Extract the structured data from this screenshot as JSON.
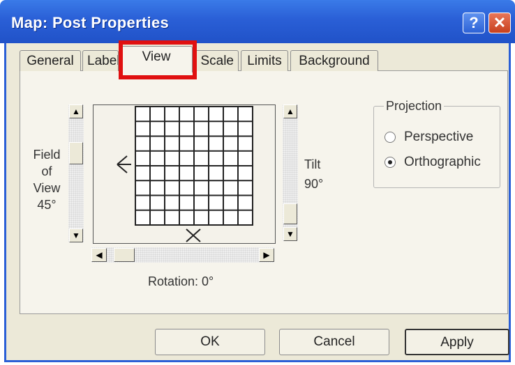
{
  "window": {
    "title": "Map: Post Properties",
    "help_glyph": "?",
    "close_glyph": "✕"
  },
  "tabs": [
    {
      "label": "General",
      "active": false
    },
    {
      "label": "Labels",
      "active": false
    },
    {
      "label": "View",
      "active": true
    },
    {
      "label": "Scale",
      "active": false
    },
    {
      "label": "Limits",
      "active": false
    },
    {
      "label": "Background",
      "active": false
    }
  ],
  "view": {
    "field_of_view": {
      "label_line1": "Field",
      "label_line2": "of",
      "label_line3": "View",
      "value": "45°"
    },
    "tilt": {
      "label": "Tilt",
      "value": "90°"
    },
    "rotation": {
      "label": "Rotation: 0°"
    }
  },
  "projection": {
    "title": "Projection",
    "options": [
      {
        "label": "Perspective",
        "selected": false
      },
      {
        "label": "Orthographic",
        "selected": true
      }
    ]
  },
  "buttons": {
    "ok": "OK",
    "cancel": "Cancel",
    "apply": "Apply"
  },
  "colors": {
    "title_bar": "#2a5fd6",
    "highlight": "#e01010",
    "dialog_face": "#ece9d8"
  }
}
